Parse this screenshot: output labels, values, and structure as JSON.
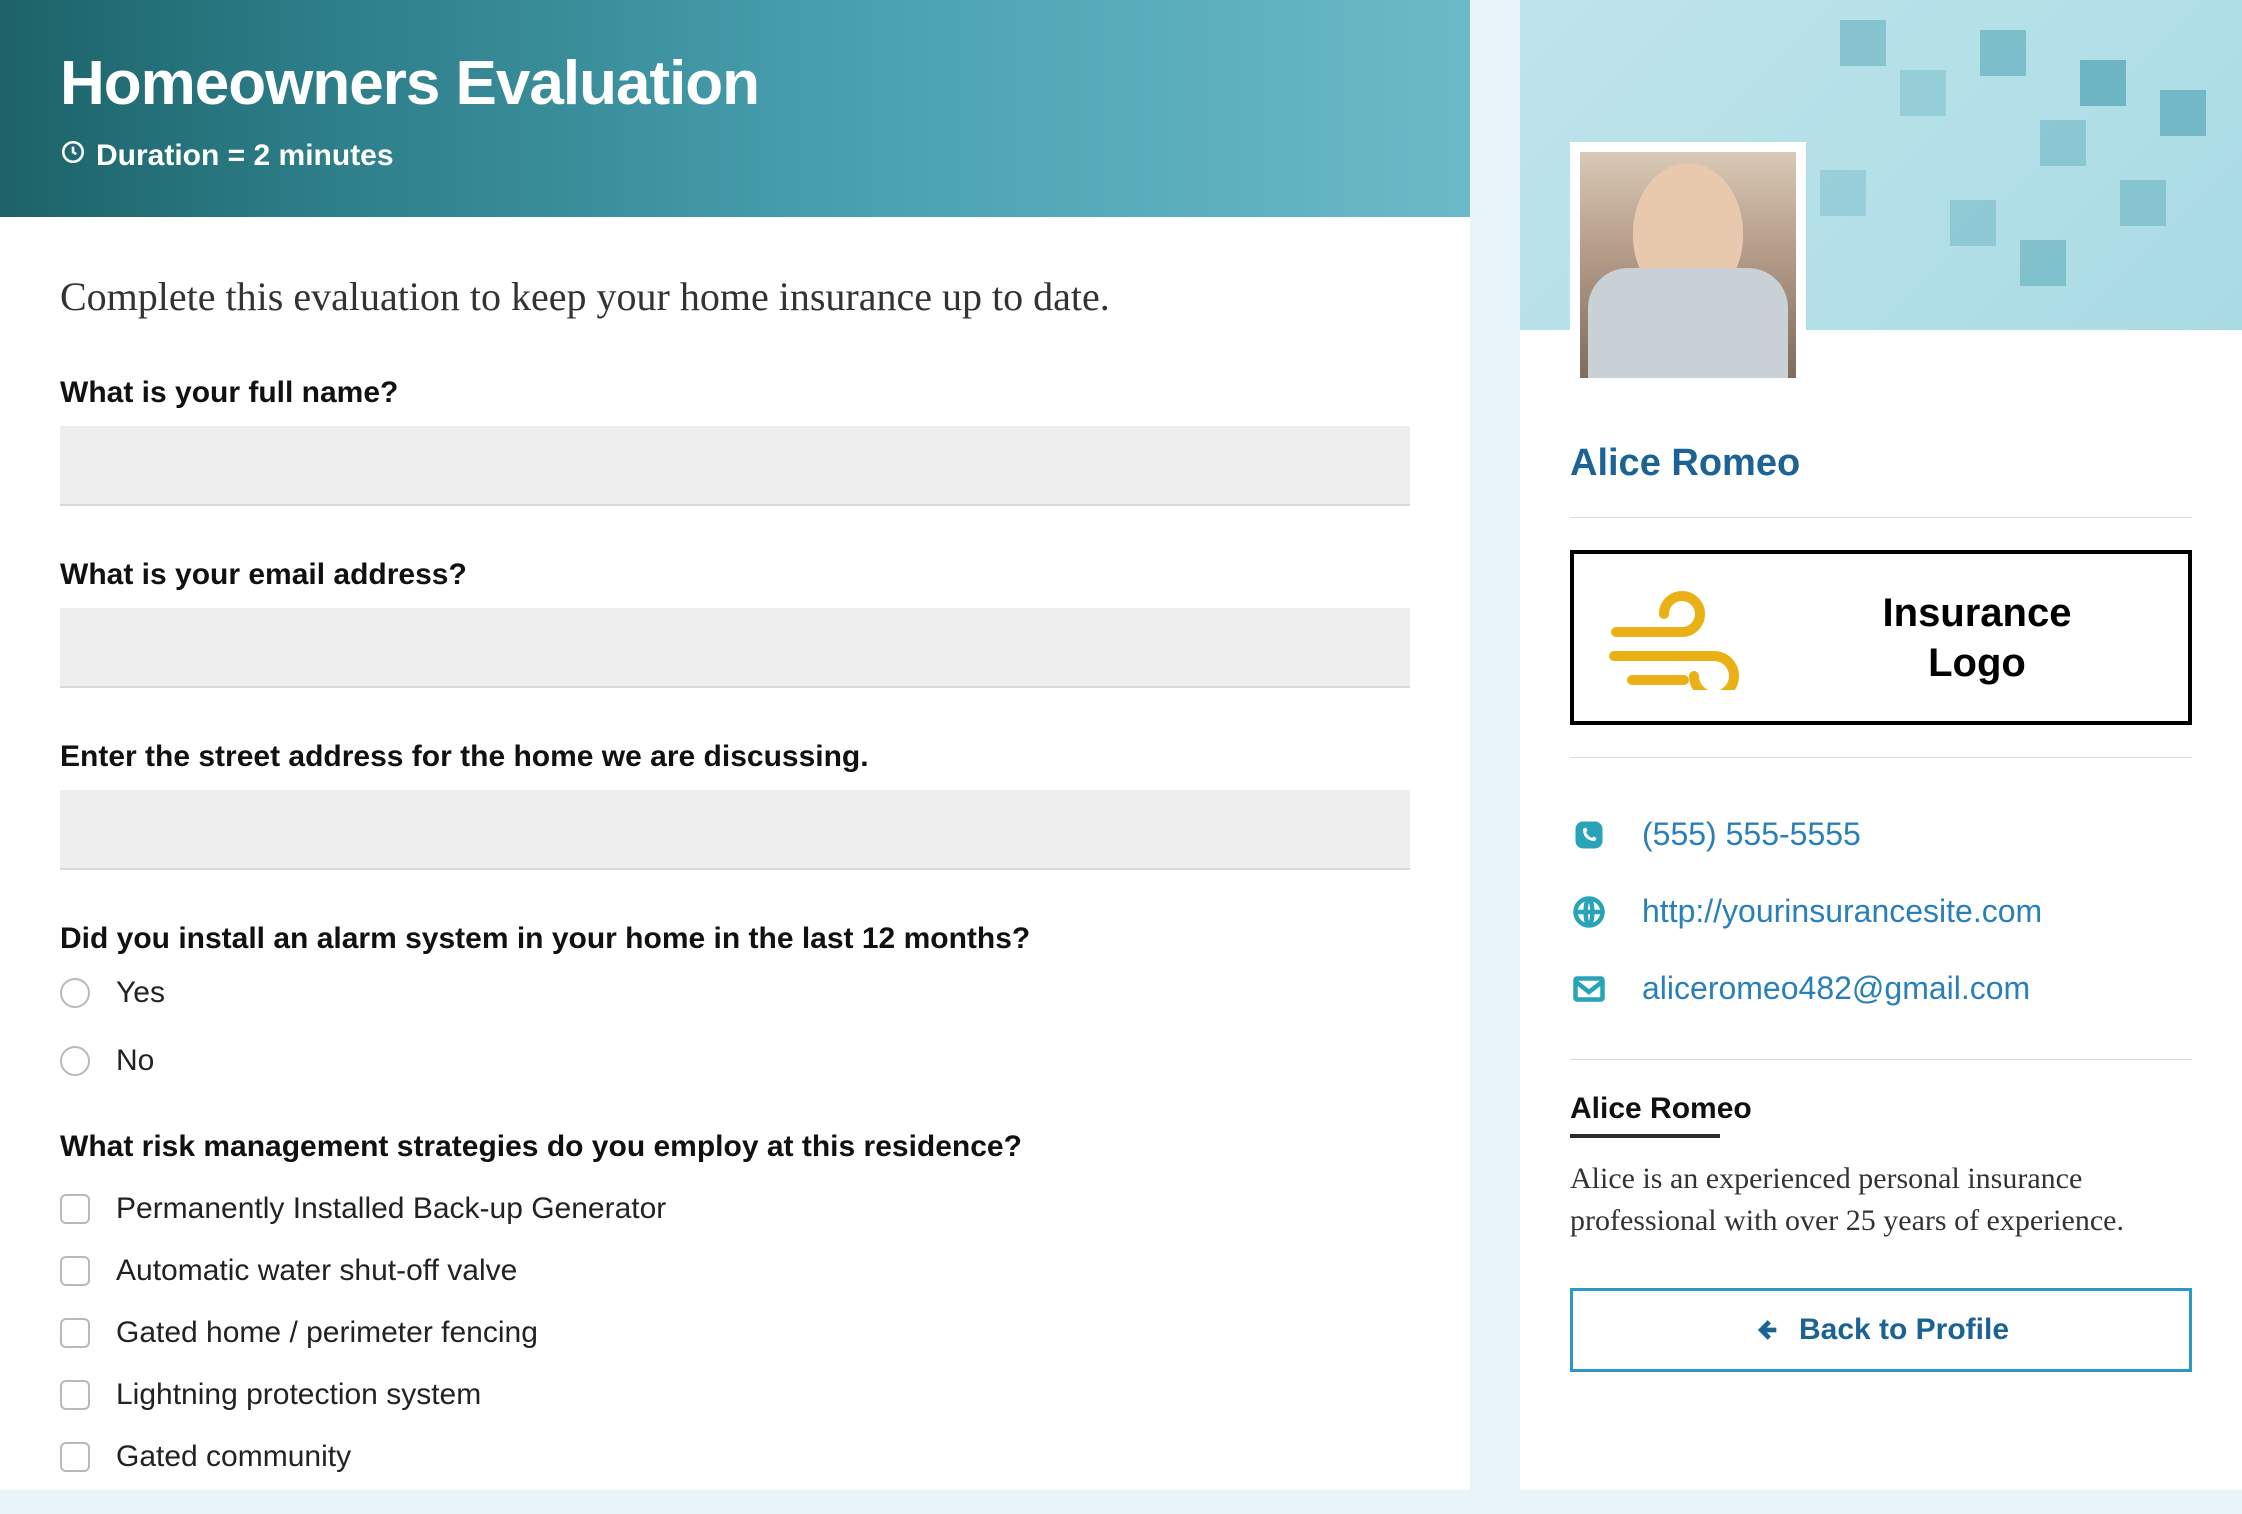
{
  "colors": {
    "brand": "#1b6394",
    "accent": "#29a3b8",
    "link": "#2980b9"
  },
  "header": {
    "title": "Homeowners Evaluation",
    "duration": "Duration = 2 minutes"
  },
  "intro": "Complete this evaluation to keep your home insurance up to date.",
  "questions": {
    "name": "What is your full name?",
    "email": "What is your email address?",
    "address": "Enter the street address for the home we are discussing.",
    "alarm": "Did you install an alarm system in your home in the last 12 months?",
    "alarm_options": [
      "Yes",
      "No"
    ],
    "risk": "What risk management strategies do you employ at this residence?",
    "risk_options": [
      "Permanently Installed Back-up Generator",
      "Automatic water shut-off valve",
      "Gated home / perimeter fencing",
      "Lightning protection system",
      "Gated community"
    ]
  },
  "agent": {
    "name": "Alice Romeo",
    "logo_line1": "Insurance",
    "logo_line2": "Logo",
    "phone": "(555) 555-5555",
    "website": "http://yourinsurancesite.com",
    "email": "aliceromeo482@gmail.com",
    "bio_name": "Alice Romeo",
    "bio": "Alice is an experienced personal insurance professional with over 25 years of experience."
  },
  "back_button": "Back to Profile"
}
